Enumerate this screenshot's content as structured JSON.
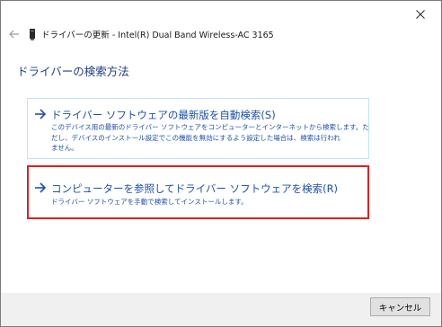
{
  "window": {
    "title": "ドライバーの更新 - Intel(R) Dual Band Wireless-AC 3165",
    "close_icon": "close-icon",
    "back_icon": "back-arrow-icon",
    "device_icon": "network-adapter-icon"
  },
  "main": {
    "heading": "ドライバーの検索方法",
    "options": [
      {
        "title": "ドライバー ソフトウェアの最新版を自動検索(S)",
        "description_lines": [
          "このデバイス用の最新のドライバー ソフトウェアをコンピューターとインターネットから検索します。た",
          "だし、デバイスのインストール設定でこの機能を無効にするよう設定した場合は、検索は行われ",
          "ません。"
        ],
        "icon": "arrow-right-icon"
      },
      {
        "title": "コンピューターを参照してドライバー ソフトウェアを検索(R)",
        "description_lines": [
          "ドライバー ソフトウェアを手動で検索してインストールします。"
        ],
        "icon": "arrow-right-icon",
        "highlight_color": "#e02020"
      }
    ]
  },
  "footer": {
    "cancel_label": "キャンセル"
  },
  "colors": {
    "link_blue": "#1c4fb0",
    "heading_blue": "#1e3e8c",
    "highlight_red": "#e02020"
  }
}
